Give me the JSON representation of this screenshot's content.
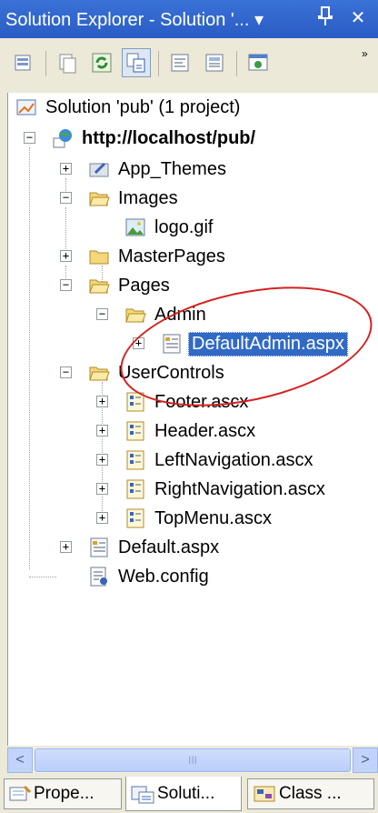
{
  "window": {
    "title": "Solution Explorer - Solution '... ▾",
    "pin_glyph": "†",
    "close_glyph": "✕"
  },
  "toolbar": {
    "icons": [
      "properties-icon",
      "show-all-files-icon",
      "refresh-icon",
      "nest-related-files-icon",
      "view-code-icon",
      "view-designer-icon",
      "copy-website-icon"
    ],
    "overflow_glyph": "»"
  },
  "tree": {
    "nodes": [
      {
        "label": "Solution 'pub' (1 project)",
        "icon": "solution-icon"
      },
      {
        "label": "http://localhost/pub/",
        "icon": "website-globe-icon"
      },
      {
        "label": "App_Themes",
        "icon": "themes-folder-icon"
      },
      {
        "label": "Images",
        "icon": "folder-open-icon"
      },
      {
        "label": "logo.gif",
        "icon": "image-file-icon"
      },
      {
        "label": "MasterPages",
        "icon": "folder-icon"
      },
      {
        "label": "Pages",
        "icon": "folder-open-icon"
      },
      {
        "label": "Admin",
        "icon": "folder-open-icon"
      },
      {
        "label": "DefaultAdmin.aspx",
        "icon": "aspx-page-icon"
      },
      {
        "label": "UserControls",
        "icon": "folder-open-icon"
      },
      {
        "label": "Footer.ascx",
        "icon": "ascx-control-icon"
      },
      {
        "label": "Header.ascx",
        "icon": "ascx-control-icon"
      },
      {
        "label": "LeftNavigation.ascx",
        "icon": "ascx-control-icon"
      },
      {
        "label": "RightNavigation.ascx",
        "icon": "ascx-control-icon"
      },
      {
        "label": "TopMenu.ascx",
        "icon": "ascx-control-icon"
      },
      {
        "label": "Default.aspx",
        "icon": "aspx-page-icon"
      },
      {
        "label": "Web.config",
        "icon": "config-file-icon"
      }
    ]
  },
  "scrollbar": {
    "left_arrow": "<",
    "right_arrow": ">",
    "grip": "III"
  },
  "tabs": [
    {
      "label": "Prope...",
      "icon": "properties-tab-icon"
    },
    {
      "label": "Soluti...",
      "icon": "solution-explorer-tab-icon"
    },
    {
      "label": "Class ...",
      "icon": "class-view-tab-icon"
    }
  ],
  "colors": {
    "selection": "#316ac5",
    "titlebar": "#2a5cc4",
    "annotation": "#d62020"
  }
}
